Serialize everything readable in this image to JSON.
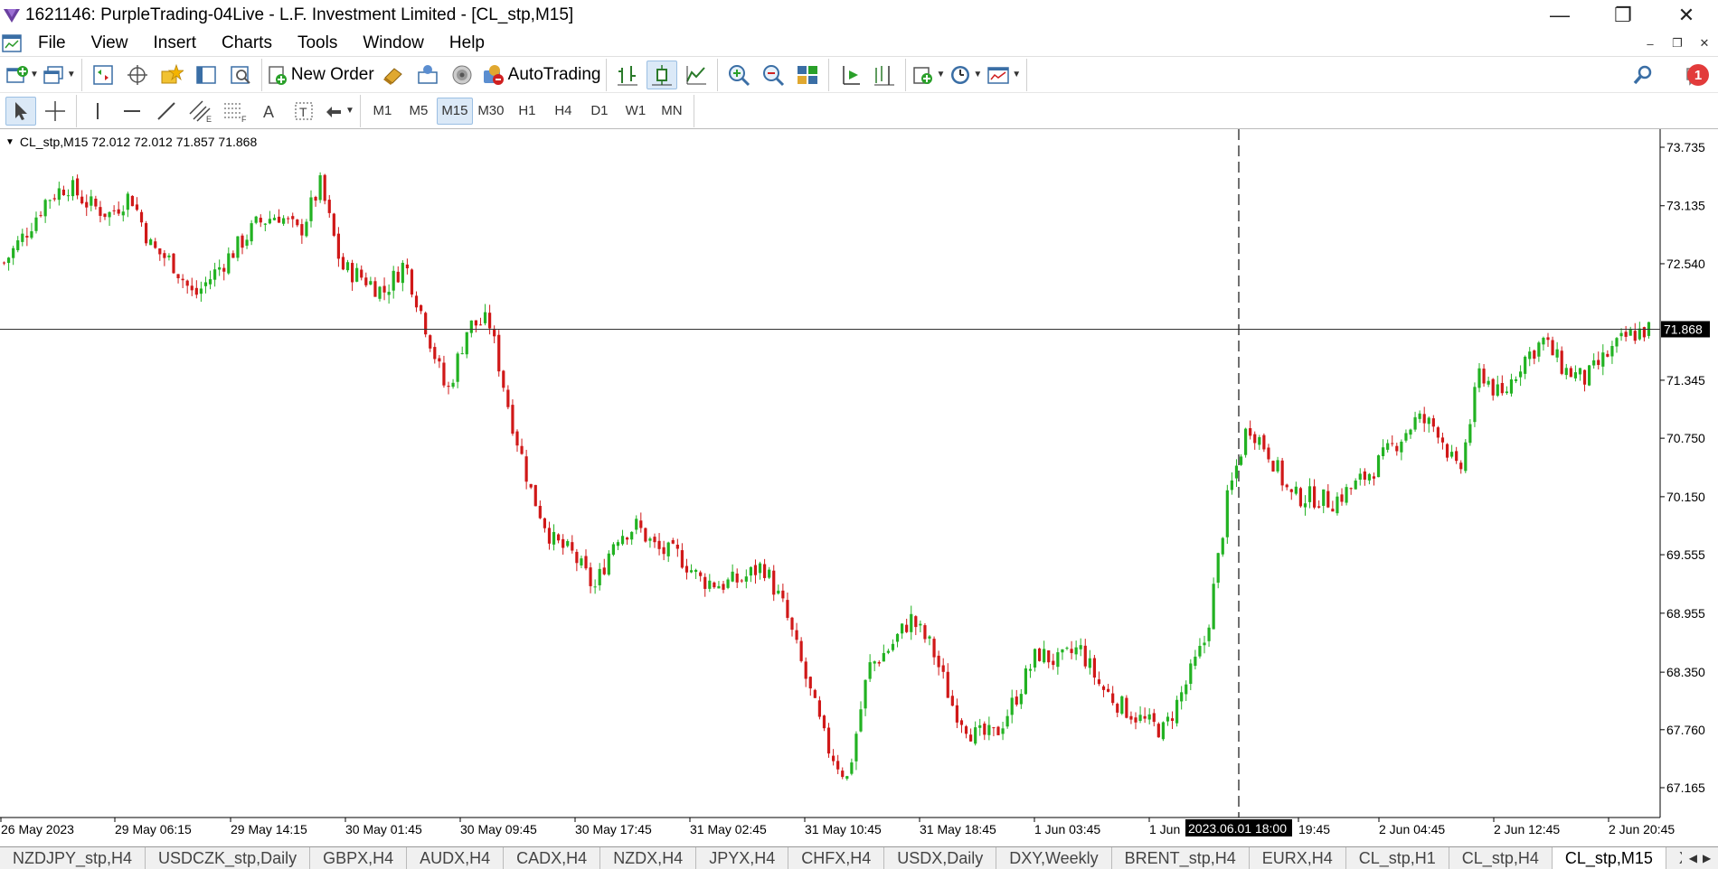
{
  "window": {
    "title": "1621146: PurpleTrading-04Live - L.F. Investment Limited - [CL_stp,M15]",
    "minimize": "—",
    "restore": "❐",
    "close": "✕"
  },
  "menu": {
    "items": [
      "File",
      "View",
      "Insert",
      "Charts",
      "Tools",
      "Window",
      "Help"
    ],
    "mdi_min": "–",
    "mdi_restore": "❐",
    "mdi_close": "✕"
  },
  "toolbar": {
    "new_order_label": "New Order",
    "autotrading_label": "AutoTrading",
    "notifications_count": "1"
  },
  "timeframes": {
    "items": [
      "M1",
      "M5",
      "M15",
      "M30",
      "H1",
      "H4",
      "D1",
      "W1",
      "MN"
    ],
    "active": "M15"
  },
  "chart": {
    "caption": "CL_stp,M15  72.012 72.012 71.857 71.868",
    "current_price_label": "71.868",
    "crosshair_time_label": "2023.06.01 18:00",
    "colors": {
      "bull": "#22b222",
      "bear": "#d01818",
      "axis": "#000000",
      "badge_bg": "#000000"
    }
  },
  "chart_data": {
    "type": "candlestick",
    "symbol": "CL_stp",
    "timeframe": "M15",
    "last_price": 71.868,
    "crosshair_time": "2023.06.01 18:00",
    "y_ticks": [
      "73.735",
      "73.135",
      "72.540",
      "71.345",
      "70.750",
      "70.150",
      "69.555",
      "68.955",
      "68.350",
      "67.760",
      "67.165"
    ],
    "y_tick_values": [
      73.735,
      73.135,
      72.54,
      71.345,
      70.75,
      70.15,
      69.555,
      68.955,
      68.35,
      67.76,
      67.165
    ],
    "x_ticks": [
      "26 May 2023",
      "29 May 06:15",
      "29 May 14:15",
      "30 May 01:45",
      "30 May 09:45",
      "30 May 17:45",
      "31 May 02:45",
      "31 May 10:45",
      "31 May 18:45",
      "1 Jun 03:45",
      "1 Jun",
      "19:45",
      "2 Jun 04:45",
      "2 Jun 12:45",
      "2 Jun 20:45"
    ],
    "close_path": [
      72.55,
      72.85,
      73.2,
      73.35,
      73.15,
      73.05,
      73.25,
      72.7,
      72.55,
      72.2,
      72.45,
      72.7,
      72.95,
      73.05,
      72.85,
      73.35,
      72.5,
      72.4,
      72.25,
      72.55,
      71.9,
      71.2,
      71.9,
      71.95,
      71.0,
      70.2,
      69.7,
      69.55,
      69.2,
      69.75,
      69.85,
      69.6,
      69.55,
      69.3,
      69.25,
      69.3,
      69.45,
      69.0,
      68.3,
      67.6,
      67.25,
      68.4,
      68.6,
      68.9,
      68.6,
      68.0,
      67.7,
      67.7,
      68.1,
      68.55,
      68.45,
      68.6,
      68.2,
      68.0,
      67.85,
      67.75,
      68.2,
      68.7,
      70.1,
      70.9,
      70.6,
      70.15,
      70.15,
      70.1,
      70.25,
      70.45,
      70.7,
      70.95,
      70.85,
      70.35,
      71.45,
      71.15,
      71.55,
      71.75,
      71.45,
      71.35,
      71.6,
      71.8,
      71.87
    ]
  },
  "tabs": {
    "items": [
      "NZDJPY_stp,H4",
      "USDCZK_stp,Daily",
      "GBPX,H4",
      "AUDX,H4",
      "CADX,H4",
      "NZDX,H4",
      "JPYX,H4",
      "CHFX,H4",
      "USDX,Daily",
      "DXY,Weekly",
      "BRENT_stp,H4",
      "EURX,H4",
      "CL_stp,H1",
      "CL_stp,H4",
      "CL_stp,M15",
      "XAUU"
    ],
    "active": "CL_stp,M15",
    "nav_left": "◀",
    "nav_right": "▶"
  }
}
